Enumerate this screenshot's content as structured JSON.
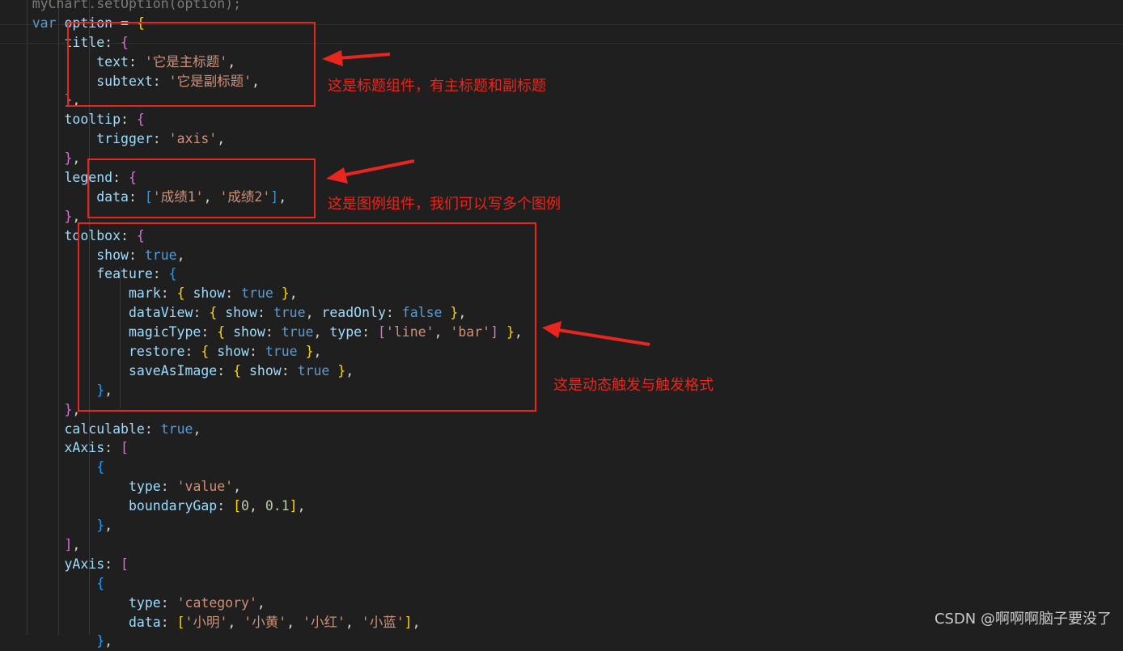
{
  "editor": {
    "lines": [
      {
        "tokens": [
          {
            "t": "    ",
            "c": "punc"
          },
          {
            "t": "myChart.setOption(option);",
            "c": "faded"
          }
        ]
      },
      {
        "tokens": [
          {
            "t": "    ",
            "c": "punc"
          },
          {
            "t": "var",
            "c": "kw"
          },
          {
            "t": " ",
            "c": "punc"
          },
          {
            "t": "option",
            "c": "var"
          },
          {
            "t": " = ",
            "c": "punc"
          },
          {
            "t": "{",
            "c": "b1"
          }
        ]
      },
      {
        "tokens": [
          {
            "t": "        ",
            "c": "punc"
          },
          {
            "t": "title",
            "c": "prop"
          },
          {
            "t": ": ",
            "c": "punc"
          },
          {
            "t": "{",
            "c": "b2"
          }
        ]
      },
      {
        "tokens": [
          {
            "t": "            ",
            "c": "punc"
          },
          {
            "t": "text",
            "c": "prop"
          },
          {
            "t": ": ",
            "c": "punc"
          },
          {
            "t": "'它是主标题'",
            "c": "str"
          },
          {
            "t": ",",
            "c": "punc"
          }
        ]
      },
      {
        "tokens": [
          {
            "t": "            ",
            "c": "punc"
          },
          {
            "t": "subtext",
            "c": "prop"
          },
          {
            "t": ": ",
            "c": "punc"
          },
          {
            "t": "'它是副标题'",
            "c": "str"
          },
          {
            "t": ",",
            "c": "punc"
          }
        ]
      },
      {
        "tokens": [
          {
            "t": "        ",
            "c": "punc"
          },
          {
            "t": "}",
            "c": "b2"
          },
          {
            "t": ",",
            "c": "punc"
          }
        ]
      },
      {
        "tokens": [
          {
            "t": "        ",
            "c": "punc"
          },
          {
            "t": "tooltip",
            "c": "prop"
          },
          {
            "t": ": ",
            "c": "punc"
          },
          {
            "t": "{",
            "c": "b2"
          }
        ]
      },
      {
        "tokens": [
          {
            "t": "            ",
            "c": "punc"
          },
          {
            "t": "trigger",
            "c": "prop"
          },
          {
            "t": ": ",
            "c": "punc"
          },
          {
            "t": "'axis'",
            "c": "str"
          },
          {
            "t": ",",
            "c": "punc"
          }
        ]
      },
      {
        "tokens": [
          {
            "t": "        ",
            "c": "punc"
          },
          {
            "t": "}",
            "c": "b2"
          },
          {
            "t": ",",
            "c": "punc"
          }
        ]
      },
      {
        "tokens": [
          {
            "t": "        ",
            "c": "punc"
          },
          {
            "t": "legend",
            "c": "prop"
          },
          {
            "t": ": ",
            "c": "punc"
          },
          {
            "t": "{",
            "c": "b2"
          }
        ]
      },
      {
        "tokens": [
          {
            "t": "            ",
            "c": "punc"
          },
          {
            "t": "data",
            "c": "prop"
          },
          {
            "t": ": ",
            "c": "punc"
          },
          {
            "t": "[",
            "c": "b3"
          },
          {
            "t": "'成绩1'",
            "c": "str"
          },
          {
            "t": ", ",
            "c": "punc"
          },
          {
            "t": "'成绩2'",
            "c": "str"
          },
          {
            "t": "]",
            "c": "b3"
          },
          {
            "t": ",",
            "c": "punc"
          }
        ]
      },
      {
        "tokens": [
          {
            "t": "        ",
            "c": "punc"
          },
          {
            "t": "}",
            "c": "b2"
          },
          {
            "t": ",",
            "c": "punc"
          }
        ]
      },
      {
        "tokens": [
          {
            "t": "        ",
            "c": "punc"
          },
          {
            "t": "toolbox",
            "c": "prop"
          },
          {
            "t": ": ",
            "c": "punc"
          },
          {
            "t": "{",
            "c": "b2"
          }
        ]
      },
      {
        "tokens": [
          {
            "t": "            ",
            "c": "punc"
          },
          {
            "t": "show",
            "c": "prop"
          },
          {
            "t": ": ",
            "c": "punc"
          },
          {
            "t": "true",
            "c": "kw"
          },
          {
            "t": ",",
            "c": "punc"
          }
        ]
      },
      {
        "tokens": [
          {
            "t": "            ",
            "c": "punc"
          },
          {
            "t": "feature",
            "c": "prop"
          },
          {
            "t": ": ",
            "c": "punc"
          },
          {
            "t": "{",
            "c": "b3"
          }
        ]
      },
      {
        "tokens": [
          {
            "t": "                ",
            "c": "punc"
          },
          {
            "t": "mark",
            "c": "prop"
          },
          {
            "t": ": ",
            "c": "punc"
          },
          {
            "t": "{",
            "c": "b1"
          },
          {
            "t": " ",
            "c": "punc"
          },
          {
            "t": "show",
            "c": "prop"
          },
          {
            "t": ": ",
            "c": "punc"
          },
          {
            "t": "true",
            "c": "kw"
          },
          {
            "t": " ",
            "c": "punc"
          },
          {
            "t": "}",
            "c": "b1"
          },
          {
            "t": ",",
            "c": "punc"
          }
        ]
      },
      {
        "tokens": [
          {
            "t": "                ",
            "c": "punc"
          },
          {
            "t": "dataView",
            "c": "prop"
          },
          {
            "t": ": ",
            "c": "punc"
          },
          {
            "t": "{",
            "c": "b1"
          },
          {
            "t": " ",
            "c": "punc"
          },
          {
            "t": "show",
            "c": "prop"
          },
          {
            "t": ": ",
            "c": "punc"
          },
          {
            "t": "true",
            "c": "kw"
          },
          {
            "t": ", ",
            "c": "punc"
          },
          {
            "t": "readOnly",
            "c": "prop"
          },
          {
            "t": ": ",
            "c": "punc"
          },
          {
            "t": "false",
            "c": "kw"
          },
          {
            "t": " ",
            "c": "punc"
          },
          {
            "t": "}",
            "c": "b1"
          },
          {
            "t": ",",
            "c": "punc"
          }
        ]
      },
      {
        "tokens": [
          {
            "t": "                ",
            "c": "punc"
          },
          {
            "t": "magicType",
            "c": "prop"
          },
          {
            "t": ": ",
            "c": "punc"
          },
          {
            "t": "{",
            "c": "b1"
          },
          {
            "t": " ",
            "c": "punc"
          },
          {
            "t": "show",
            "c": "prop"
          },
          {
            "t": ": ",
            "c": "punc"
          },
          {
            "t": "true",
            "c": "kw"
          },
          {
            "t": ", ",
            "c": "punc"
          },
          {
            "t": "type",
            "c": "prop"
          },
          {
            "t": ": ",
            "c": "punc"
          },
          {
            "t": "[",
            "c": "b2"
          },
          {
            "t": "'line'",
            "c": "str"
          },
          {
            "t": ", ",
            "c": "punc"
          },
          {
            "t": "'bar'",
            "c": "str"
          },
          {
            "t": "]",
            "c": "b2"
          },
          {
            "t": " ",
            "c": "punc"
          },
          {
            "t": "}",
            "c": "b1"
          },
          {
            "t": ",",
            "c": "punc"
          }
        ]
      },
      {
        "tokens": [
          {
            "t": "                ",
            "c": "punc"
          },
          {
            "t": "restore",
            "c": "prop"
          },
          {
            "t": ": ",
            "c": "punc"
          },
          {
            "t": "{",
            "c": "b1"
          },
          {
            "t": " ",
            "c": "punc"
          },
          {
            "t": "show",
            "c": "prop"
          },
          {
            "t": ": ",
            "c": "punc"
          },
          {
            "t": "true",
            "c": "kw"
          },
          {
            "t": " ",
            "c": "punc"
          },
          {
            "t": "}",
            "c": "b1"
          },
          {
            "t": ",",
            "c": "punc"
          }
        ]
      },
      {
        "tokens": [
          {
            "t": "                ",
            "c": "punc"
          },
          {
            "t": "saveAsImage",
            "c": "prop"
          },
          {
            "t": ": ",
            "c": "punc"
          },
          {
            "t": "{",
            "c": "b1"
          },
          {
            "t": " ",
            "c": "punc"
          },
          {
            "t": "show",
            "c": "prop"
          },
          {
            "t": ": ",
            "c": "punc"
          },
          {
            "t": "true",
            "c": "kw"
          },
          {
            "t": " ",
            "c": "punc"
          },
          {
            "t": "}",
            "c": "b1"
          },
          {
            "t": ",",
            "c": "punc"
          }
        ]
      },
      {
        "tokens": [
          {
            "t": "            ",
            "c": "punc"
          },
          {
            "t": "}",
            "c": "b3"
          },
          {
            "t": ",",
            "c": "punc"
          }
        ]
      },
      {
        "tokens": [
          {
            "t": "        ",
            "c": "punc"
          },
          {
            "t": "}",
            "c": "b2"
          },
          {
            "t": ",",
            "c": "punc"
          }
        ]
      },
      {
        "tokens": [
          {
            "t": "        ",
            "c": "punc"
          },
          {
            "t": "calculable",
            "c": "prop"
          },
          {
            "t": ": ",
            "c": "punc"
          },
          {
            "t": "true",
            "c": "kw"
          },
          {
            "t": ",",
            "c": "punc"
          }
        ]
      },
      {
        "tokens": [
          {
            "t": "        ",
            "c": "punc"
          },
          {
            "t": "xAxis",
            "c": "prop"
          },
          {
            "t": ": ",
            "c": "punc"
          },
          {
            "t": "[",
            "c": "b2"
          }
        ]
      },
      {
        "tokens": [
          {
            "t": "            ",
            "c": "punc"
          },
          {
            "t": "{",
            "c": "b3"
          }
        ]
      },
      {
        "tokens": [
          {
            "t": "                ",
            "c": "punc"
          },
          {
            "t": "type",
            "c": "prop"
          },
          {
            "t": ": ",
            "c": "punc"
          },
          {
            "t": "'value'",
            "c": "str"
          },
          {
            "t": ",",
            "c": "punc"
          }
        ]
      },
      {
        "tokens": [
          {
            "t": "                ",
            "c": "punc"
          },
          {
            "t": "boundaryGap",
            "c": "prop"
          },
          {
            "t": ": ",
            "c": "punc"
          },
          {
            "t": "[",
            "c": "b1"
          },
          {
            "t": "0",
            "c": "num"
          },
          {
            "t": ", ",
            "c": "punc"
          },
          {
            "t": "0.1",
            "c": "num"
          },
          {
            "t": "]",
            "c": "b1"
          },
          {
            "t": ",",
            "c": "punc"
          }
        ]
      },
      {
        "tokens": [
          {
            "t": "            ",
            "c": "punc"
          },
          {
            "t": "}",
            "c": "b3"
          },
          {
            "t": ",",
            "c": "punc"
          }
        ]
      },
      {
        "tokens": [
          {
            "t": "        ",
            "c": "punc"
          },
          {
            "t": "]",
            "c": "b2"
          },
          {
            "t": ",",
            "c": "punc"
          }
        ]
      },
      {
        "tokens": [
          {
            "t": "        ",
            "c": "punc"
          },
          {
            "t": "yAxis",
            "c": "prop"
          },
          {
            "t": ": ",
            "c": "punc"
          },
          {
            "t": "[",
            "c": "b2"
          }
        ]
      },
      {
        "tokens": [
          {
            "t": "            ",
            "c": "punc"
          },
          {
            "t": "{",
            "c": "b3"
          }
        ]
      },
      {
        "tokens": [
          {
            "t": "                ",
            "c": "punc"
          },
          {
            "t": "type",
            "c": "prop"
          },
          {
            "t": ": ",
            "c": "punc"
          },
          {
            "t": "'category'",
            "c": "str"
          },
          {
            "t": ",",
            "c": "punc"
          }
        ]
      },
      {
        "tokens": [
          {
            "t": "                ",
            "c": "punc"
          },
          {
            "t": "data",
            "c": "prop"
          },
          {
            "t": ": ",
            "c": "punc"
          },
          {
            "t": "[",
            "c": "b1"
          },
          {
            "t": "'小明'",
            "c": "str"
          },
          {
            "t": ", ",
            "c": "punc"
          },
          {
            "t": "'小黄'",
            "c": "str"
          },
          {
            "t": ", ",
            "c": "punc"
          },
          {
            "t": "'小红'",
            "c": "str"
          },
          {
            "t": ", ",
            "c": "punc"
          },
          {
            "t": "'小蓝'",
            "c": "str"
          },
          {
            "t": "]",
            "c": "b1"
          },
          {
            "t": ",",
            "c": "punc"
          }
        ]
      },
      {
        "tokens": [
          {
            "t": "            ",
            "c": "punc"
          },
          {
            "t": "}",
            "c": "b3"
          },
          {
            "t": ",",
            "c": "punc"
          }
        ]
      }
    ]
  },
  "annotations": {
    "title_note": "这是标题组件，有主标题和副标题",
    "legend_note": "这是图例组件，我们可以写多个图例",
    "toolbox_note": "这是动态触发与触发格式",
    "color": "#e8261d"
  },
  "watermark": "CSDN @啊啊啊脑子要没了"
}
